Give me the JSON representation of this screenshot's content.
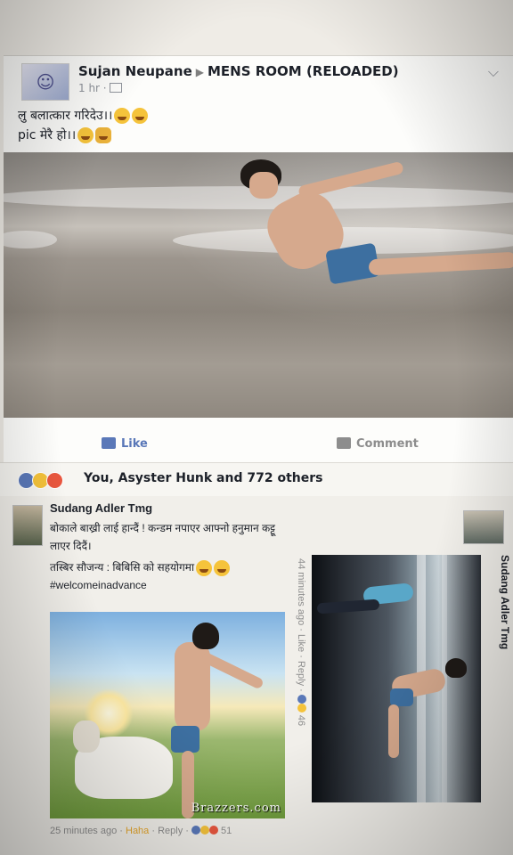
{
  "post": {
    "author": "Sujan Neupane",
    "group": "MENS ROOM (RELOADED)",
    "time": "1 hr ·",
    "text_line1": "लु बलात्कार गरिदेउ।।",
    "text_line2": "pic मेरै हो।।"
  },
  "actions": {
    "like": "Like",
    "comment": "Comment"
  },
  "reactions": {
    "summary": "You, Asyster Hunk and 772 others"
  },
  "comment1": {
    "author": "Sudang Adler Tmg",
    "text": "बोकाले बाख्री लाई हान्दैं ! कन्डम नपाएर आफ्नो हनुमान कट्टू लाएर दिदैं।",
    "credit": "तस्बिर सौजन्य : बिबिसि को सहयोगमा",
    "hashtag": "#welcomeinadvance",
    "watermark": "Brazzers.com",
    "time": "25 minutes ago",
    "haha": "Haha",
    "reply": "Reply",
    "count": "51"
  },
  "comment2": {
    "author": "Sudang Adler Tmg",
    "meta": "44 minutes ago · Like · Reply ·",
    "count": "46"
  },
  "colors": {
    "fb_blue": "#5a78b8",
    "meta_gray": "#8d8d8d",
    "haha_orange": "#e5a52a"
  }
}
